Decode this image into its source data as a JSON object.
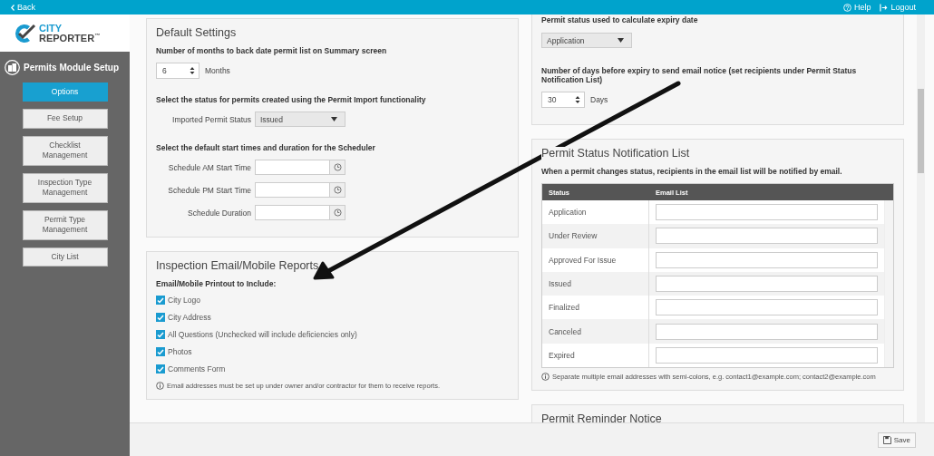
{
  "top_bar": {
    "back": "Back",
    "help": "Help",
    "logout": "Logout"
  },
  "logo": {
    "line1": "CITY",
    "line2": "REPORTER",
    "mark": "™"
  },
  "sidebar": {
    "title": "Permits Module Setup",
    "items": [
      {
        "label": "Options",
        "selected": true
      },
      {
        "label": "Fee Setup",
        "selected": false
      },
      {
        "label": "Checklist Management",
        "selected": false
      },
      {
        "label": "Inspection Type Management",
        "selected": false
      },
      {
        "label": "Permit Type Management",
        "selected": false
      },
      {
        "label": "City List",
        "selected": false
      }
    ]
  },
  "default_settings": {
    "title": "Default Settings",
    "months_label": "Number of months to back date permit list on Summary screen",
    "months_value": "6",
    "months_unit": "Months",
    "import_label": "Select the status for permits created using the Permit Import functionality",
    "import_field": "Imported Permit Status",
    "import_value": "Issued",
    "scheduler_label": "Select the default start times and duration for the Scheduler",
    "scheduler_fields": [
      "Schedule AM Start Time",
      "Schedule PM Start Time",
      "Schedule Duration"
    ]
  },
  "inspection_reports": {
    "title": "Inspection Email/Mobile Reports",
    "subtitle": "Email/Mobile Printout to Include:",
    "options": [
      {
        "label": "City Logo",
        "checked": true
      },
      {
        "label": "City Address",
        "checked": true
      },
      {
        "label": "All Questions (Unchecked will include deficiencies only)",
        "checked": true
      },
      {
        "label": "Photos",
        "checked": true
      },
      {
        "label": "Comments Form",
        "checked": true
      }
    ],
    "note": "Email addresses must be set up under owner and/or contractor for them to receive reports."
  },
  "expiry": {
    "status_label": "Permit status used to calculate expiry date",
    "status_value": "Application",
    "days_label": "Number of days before expiry to send email notice (set recipients under Permit Status Notification List)",
    "days_value": "30",
    "days_unit": "Days"
  },
  "notification_list": {
    "title": "Permit Status Notification List",
    "description": "When a permit changes status, recipients in the email list will be notified by email.",
    "columns": [
      "Status",
      "Email List"
    ],
    "rows": [
      {
        "status": "Application"
      },
      {
        "status": "Under Review"
      },
      {
        "status": "Approved For Issue"
      },
      {
        "status": "Issued"
      },
      {
        "status": "Finalized"
      },
      {
        "status": "Canceled"
      },
      {
        "status": "Expired"
      }
    ],
    "note": "Separate multiple email addresses with semi-colons, e.g. contact1@example.com; contact2@example.com"
  },
  "reminder": {
    "title": "Permit Reminder Notice"
  },
  "footer": {
    "save": "Save"
  }
}
